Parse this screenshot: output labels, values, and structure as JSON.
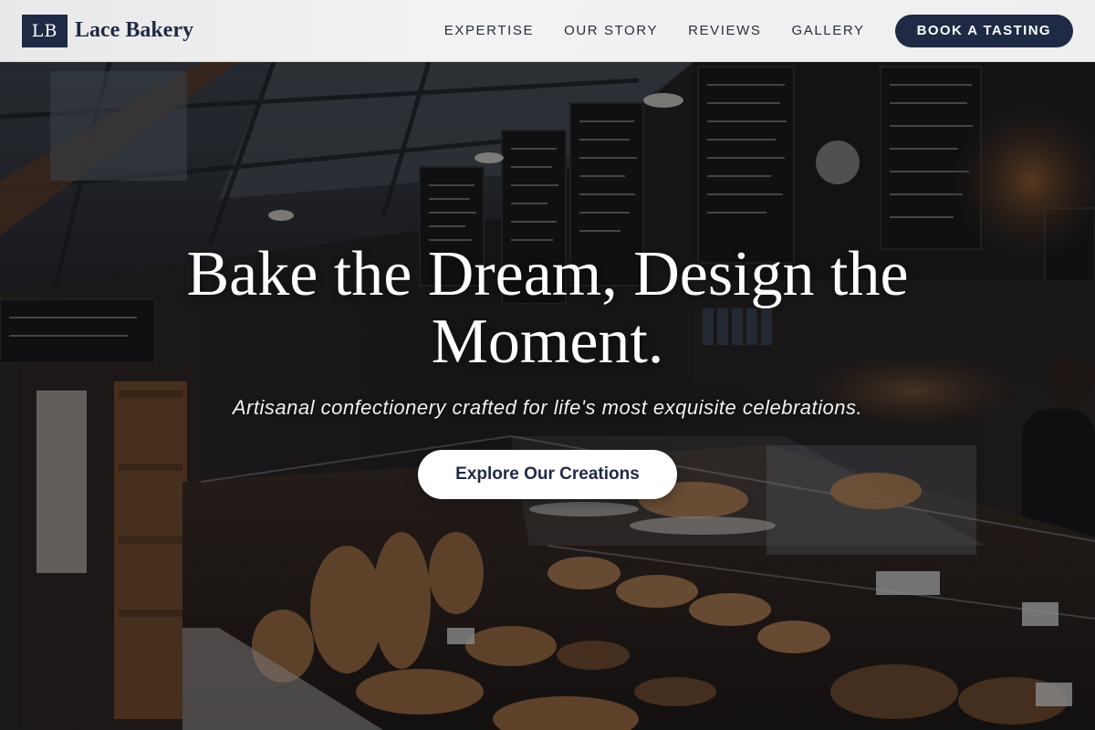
{
  "brand": {
    "mark": "LB",
    "name": "Lace Bakery"
  },
  "nav": {
    "items": [
      {
        "label": "EXPERTISE"
      },
      {
        "label": "OUR STORY"
      },
      {
        "label": "REVIEWS"
      },
      {
        "label": "GALLERY"
      }
    ],
    "cta_label": "BOOK A TASTING"
  },
  "hero": {
    "headline": "Bake the Dream, Design the Moment.",
    "subheadline": "Artisanal confectionery crafted for life's most exquisite celebrations.",
    "button_label": "Explore Our Creations"
  },
  "colors": {
    "brand_navy": "#1f2a44",
    "header_bg": "#efefef",
    "button_bg": "#ffffff"
  }
}
